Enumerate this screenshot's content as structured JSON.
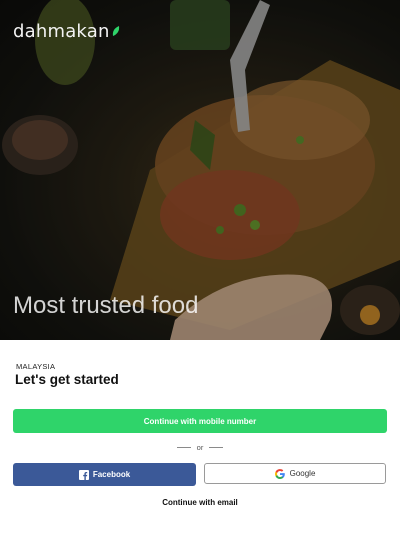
{
  "brand": {
    "logo_text": "dahmakan",
    "accent": "#2fd46a"
  },
  "hero": {
    "headline": "Most trusted food"
  },
  "sheet": {
    "country": "MALAYSIA",
    "heading": "Let's get started",
    "mobile_button": "Continue with mobile number",
    "divider_text": "or",
    "facebook_button": "Facebook",
    "google_button": "Google",
    "email_link": "Continue with email"
  },
  "colors": {
    "facebook": "#3b5998",
    "mobile": "#2fd46a"
  }
}
